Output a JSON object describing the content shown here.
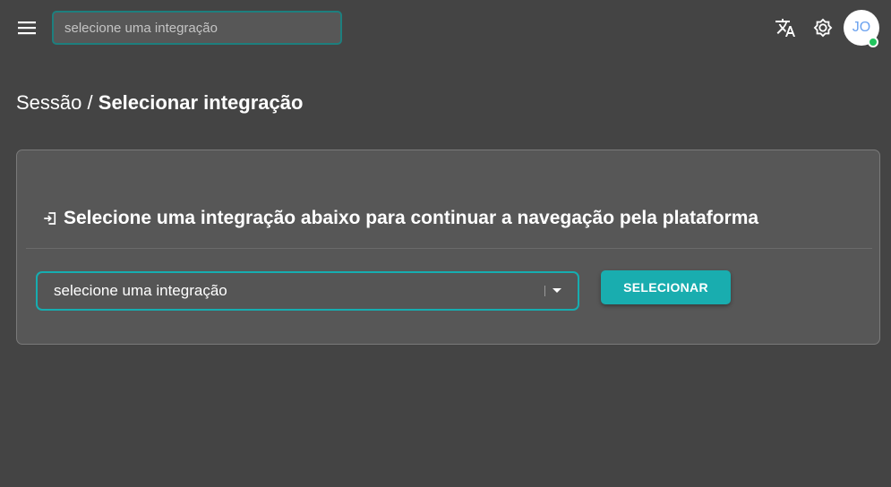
{
  "topbar": {
    "menu_icon": "hamburger-icon",
    "search_placeholder": "selecione uma integração",
    "translate_icon": "translate-icon",
    "theme_icon": "brightness-icon",
    "avatar_initials": "JO",
    "status": "online"
  },
  "breadcrumb": {
    "parent": "Sessão",
    "separator": "/",
    "current": "Selecionar integração"
  },
  "card": {
    "title_icon": "login-icon",
    "title": "Selecione uma integração abaixo para continuar a navegação pela plataforma",
    "select_value": "selecione uma integração",
    "button_label": "SELECIONAR"
  },
  "colors": {
    "background": "#444444",
    "card": "#575757",
    "accent": "#19adaf",
    "avatar_text": "#6ba2ef",
    "status_online": "#22c55e"
  }
}
